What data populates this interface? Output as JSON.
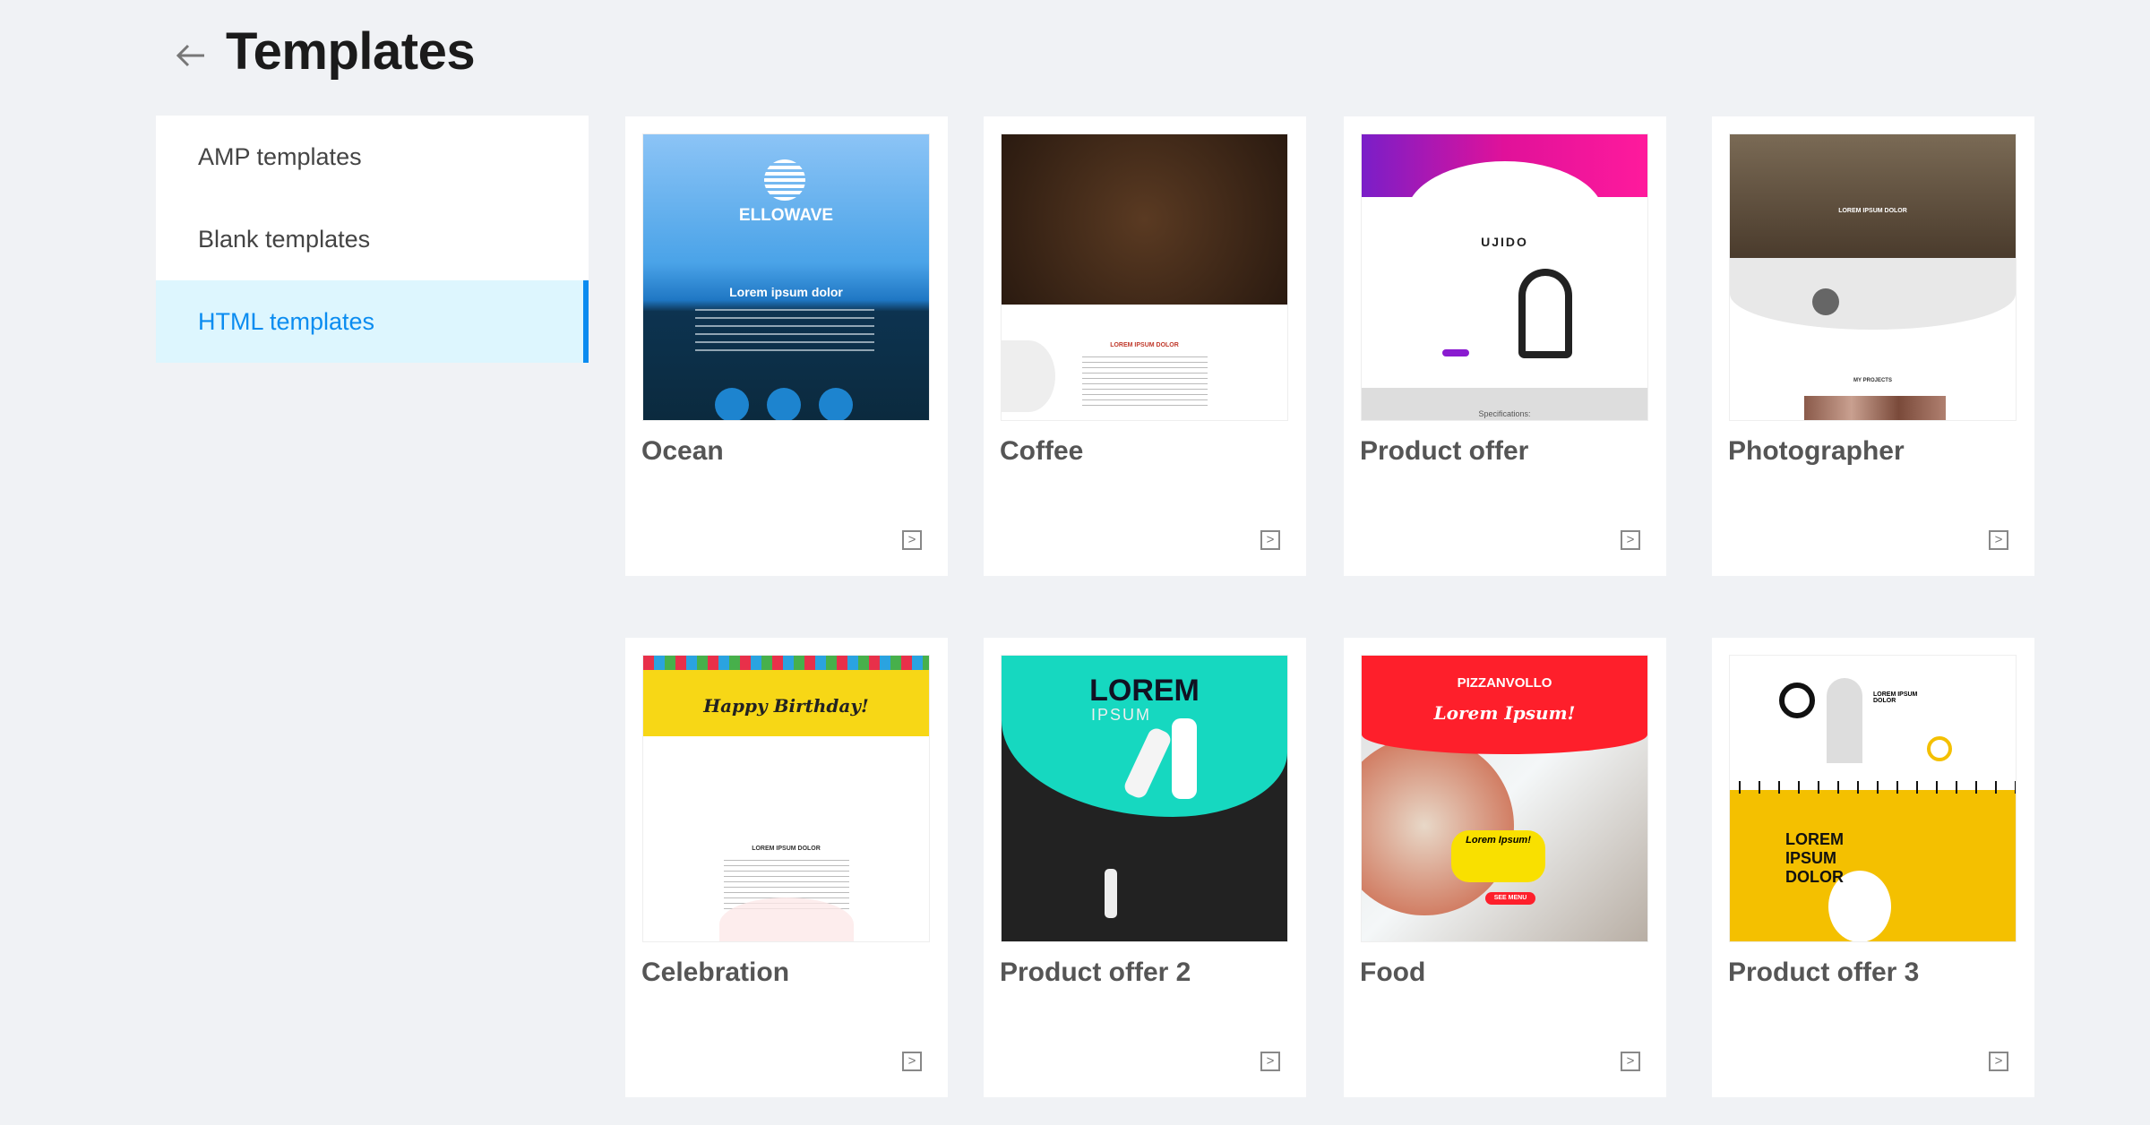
{
  "header": {
    "title": "Templates",
    "back_icon": "arrow-left-icon"
  },
  "sidebar": {
    "items": [
      {
        "label": "AMP templates",
        "active": false
      },
      {
        "label": "Blank templates",
        "active": false
      },
      {
        "label": "HTML templates",
        "active": true
      }
    ]
  },
  "colors": {
    "accent": "#0a8cf0",
    "active_bg": "#ddf6fe",
    "background": "#f0f2f5"
  },
  "templates": [
    {
      "name": "Ocean",
      "style": "ocean",
      "logo": "ELLOWAVE",
      "headline": "Lorem ipsum dolor"
    },
    {
      "name": "Coffee",
      "style": "coffee",
      "logo": "",
      "headline": "LOREM IPSUM DOLOR"
    },
    {
      "name": "Product offer",
      "style": "product",
      "logo": "UJIDO",
      "headline": "Specifications:"
    },
    {
      "name": "Photographer",
      "style": "photo",
      "logo": "LOREM IPSUM DOLOR",
      "headline": "MY PROJECTS"
    },
    {
      "name": "Celebration",
      "style": "celebration",
      "logo": "Happy Birthday!",
      "headline": "LOREM IPSUM DOLOR"
    },
    {
      "name": "Product offer 2",
      "style": "product2",
      "logo": "LOREM",
      "headline": "IPSUM"
    },
    {
      "name": "Food",
      "style": "food",
      "logo": "PIZZANVOLLO",
      "headline": "Lorem Ipsum!"
    },
    {
      "name": "Product offer 3",
      "style": "product3",
      "logo": "LOREM IPSUM DOLOR",
      "headline": "LOREM IPSUM DOLOR"
    }
  ],
  "card_action_icon": "open-preview-icon"
}
